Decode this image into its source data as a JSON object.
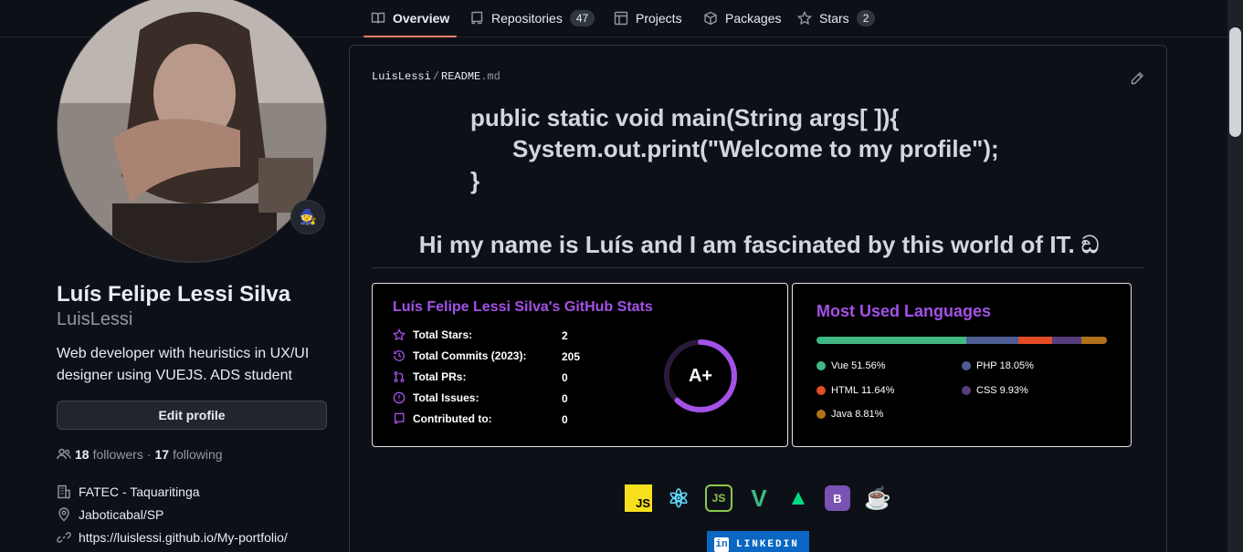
{
  "tabs": [
    {
      "label": "Overview",
      "count": ""
    },
    {
      "label": "Repositories",
      "count": "47"
    },
    {
      "label": "Projects",
      "count": ""
    },
    {
      "label": "Packages",
      "count": ""
    },
    {
      "label": "Stars",
      "count": "2"
    }
  ],
  "profile": {
    "status_emoji": "🧙",
    "full_name": "Luís Felipe Lessi Silva",
    "login": "LuisLessi",
    "bio": "Web developer with heuristics in UX/UI designer using VUEJS. ADS student",
    "edit_label": "Edit profile",
    "followers_count": "18",
    "followers_label": "followers",
    "separator": "·",
    "following_count": "17",
    "following_label": "following",
    "organization": "FATEC - Taquaritinga",
    "location": "Jaboticabal/SP",
    "website": "https://luislessi.github.io/My-portfolio/"
  },
  "readme": {
    "owner": "LuisLessi",
    "separator": "/",
    "file_name": "README",
    "file_ext": ".md",
    "code_line_1": "public static void main(String args[ ]){",
    "code_line_2": "System.out.print(\"Welcome to my profile\");",
    "code_line_3": "}",
    "greeting": "Hi my name is Luís and I am fascinated by this world of IT. ඞ"
  },
  "stats_card": {
    "title": "Luís Felipe Lessi Silva's GitHub Stats",
    "rows": [
      {
        "label": "Total Stars:",
        "value": "2",
        "icon": "star-icon"
      },
      {
        "label": "Total Commits (2023):",
        "value": "205",
        "icon": "history-icon"
      },
      {
        "label": "Total PRs:",
        "value": "0",
        "icon": "pull-request-icon"
      },
      {
        "label": "Total Issues:",
        "value": "0",
        "icon": "issue-icon"
      },
      {
        "label": "Contributed to:",
        "value": "0",
        "icon": "repo-icon"
      }
    ],
    "rank": "A+",
    "rank_progress": 0.62,
    "accent": "#a352e6"
  },
  "lang_card": {
    "title": "Most Used Languages",
    "languages": [
      {
        "name": "Vue",
        "pct": "51.56%",
        "value": 51.56,
        "color": "#41b883"
      },
      {
        "name": "PHP",
        "pct": "18.05%",
        "value": 18.05,
        "color": "#4f5d95"
      },
      {
        "name": "HTML",
        "pct": "11.64%",
        "value": 11.64,
        "color": "#e34c26"
      },
      {
        "name": "CSS",
        "pct": "9.93%",
        "value": 9.93,
        "color": "#563d7c"
      },
      {
        "name": "Java",
        "pct": "8.81%",
        "value": 8.81,
        "color": "#b07219"
      }
    ]
  },
  "tech_icons": [
    {
      "name": "javascript-icon",
      "glyph": "JS"
    },
    {
      "name": "react-icon",
      "glyph": "⚛"
    },
    {
      "name": "nodejs-icon",
      "glyph": "JS"
    },
    {
      "name": "vue-icon",
      "glyph": "V"
    },
    {
      "name": "nuxt-icon",
      "glyph": "▲"
    },
    {
      "name": "bootstrap-icon",
      "glyph": "B"
    },
    {
      "name": "java-icon",
      "glyph": "☕"
    }
  ],
  "linkedin_label": "LINKEDIN",
  "linkedin_logo": "in"
}
